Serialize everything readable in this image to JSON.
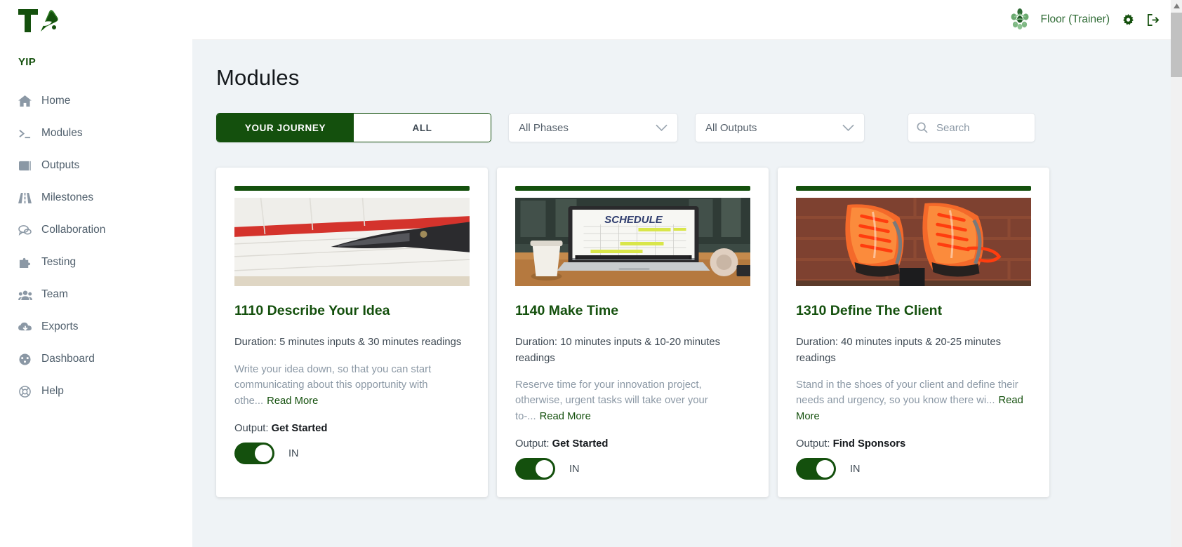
{
  "brand": {
    "logo_text": "T",
    "logo_icon": "rocket-logo-icon",
    "accent_color": "#14500d",
    "org_name": "YIP"
  },
  "sidebar": {
    "items": [
      {
        "label": "Home",
        "icon": "home-icon"
      },
      {
        "label": "Modules",
        "icon": "terminal-icon"
      },
      {
        "label": "Outputs",
        "icon": "book-icon"
      },
      {
        "label": "Milestones",
        "icon": "road-icon"
      },
      {
        "label": "Collaboration",
        "icon": "comments-icon"
      },
      {
        "label": "Testing",
        "icon": "puzzle-icon"
      },
      {
        "label": "Team",
        "icon": "users-icon"
      },
      {
        "label": "Exports",
        "icon": "cloud-download-icon"
      },
      {
        "label": "Dashboard",
        "icon": "gauge-icon"
      },
      {
        "label": "Help",
        "icon": "lifering-icon"
      }
    ]
  },
  "topbar": {
    "avatar_icon": "user-avatar-icon",
    "user_name": "Floor (Trainer)",
    "settings_icon": "gear-icon",
    "logout_icon": "logout-icon"
  },
  "page": {
    "title": "Modules"
  },
  "filters": {
    "tabs": [
      {
        "label": "YOUR JOURNEY",
        "active": true
      },
      {
        "label": "ALL",
        "active": false
      }
    ],
    "phase_select": {
      "value": "All Phases",
      "icon": "chevron-down-icon"
    },
    "output_select": {
      "value": "All Outputs",
      "icon": "chevron-down-icon"
    },
    "search": {
      "value": "",
      "placeholder": "Search",
      "icon": "search-icon"
    }
  },
  "cards": [
    {
      "title": "1110 Describe Your Idea",
      "duration": "Duration: 5 minutes inputs & 30 minutes readings",
      "description": "Write your idea down, so that you can start communicating about this opportunity with othe...",
      "read_more": "Read More",
      "output_label": "Output:",
      "output_value": "Get Started",
      "toggle_state": "IN",
      "image": "notebook-with-pen-image"
    },
    {
      "title": "1140 Make Time",
      "duration": "Duration: 10 minutes inputs & 10-20 minutes readings",
      "description": "Reserve time for your innovation project, otherwise,  urgent tasks will take over your to-...",
      "read_more": "Read More",
      "output_label": "Output:",
      "output_value": "Get Started",
      "toggle_state": "IN",
      "image": "laptop-schedule-image"
    },
    {
      "title": "1310 Define The Client",
      "duration": "Duration: 40 minutes inputs & 20-25 minutes readings",
      "description": "Stand in the shoes of your client and define their needs and urgency, so you know there wi...",
      "read_more": "Read More",
      "output_label": "Output:",
      "output_value": "Find Sponsors",
      "toggle_state": "IN",
      "image": "orange-running-shoes-image"
    }
  ],
  "scrollbar": {
    "up_arrow_icon": "caret-up-icon"
  }
}
